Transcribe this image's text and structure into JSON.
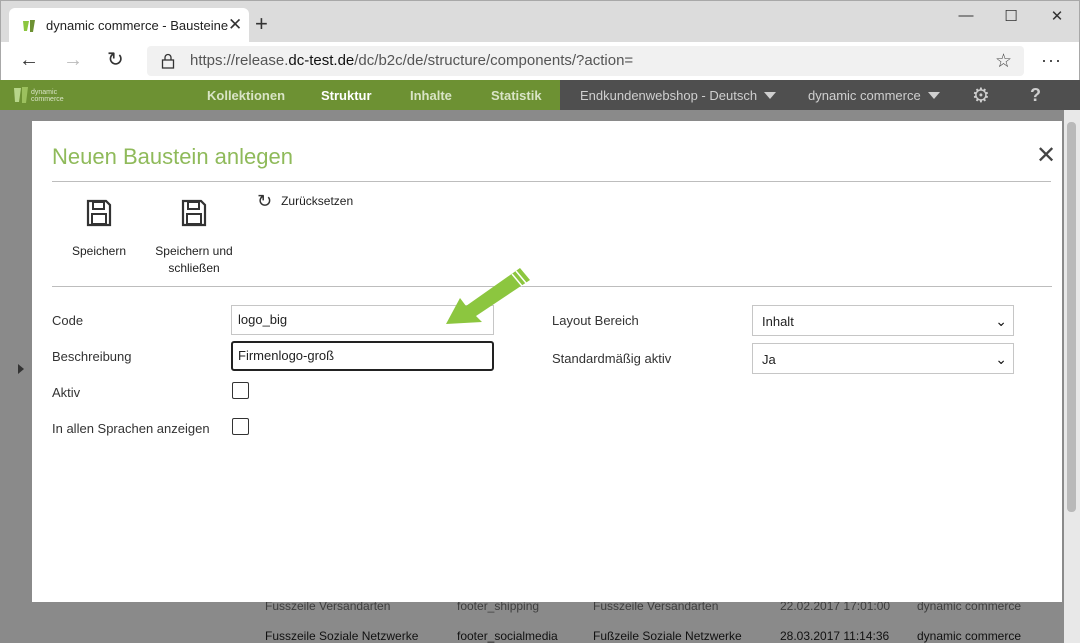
{
  "browser": {
    "tab_title": "dynamic commerce - Bausteine",
    "url_prefix": "https://release.",
    "url_domain": "dc-test.de",
    "url_path": "/dc/b2c/de/structure/components/?action="
  },
  "app": {
    "logo_text_1": "dynamic",
    "logo_text_2": "commerce",
    "nav": [
      "Kollektionen",
      "Struktur",
      "Inhalte",
      "Statistik"
    ],
    "shop_selector": "Endkundenwebshop - Deutsch",
    "company_selector": "dynamic commerce",
    "help": "?"
  },
  "background_rows": [
    [
      "Fusszeile Versandarten",
      "footer_shipping",
      "Fusszeile Versandarten",
      "22.02.2017 17:01:00",
      "dynamic commerce"
    ],
    [
      "Fusszeile Soziale Netzwerke",
      "footer_socialmedia",
      "Fußzeile Soziale Netzwerke",
      "28.03.2017 11:14:36",
      "dynamic commerce"
    ]
  ],
  "modal": {
    "title": "Neuen Baustein anlegen",
    "toolbar": {
      "save": "Speichern",
      "save_close_1": "Speichern und",
      "save_close_2": "schließen",
      "reset": "Zurücksetzen"
    },
    "form": {
      "code_label": "Code",
      "code_value": "logo_big",
      "description_label": "Beschreibung",
      "description_value": "Firmenlogo-groß",
      "active_label": "Aktiv",
      "active_checked": false,
      "all_languages_label": "In allen Sprachen anzeigen",
      "all_languages_checked": false,
      "layout_area_label": "Layout Bereich",
      "layout_area_value": "Inhalt",
      "default_active_label": "Standardmäßig aktiv",
      "default_active_value": "Ja"
    }
  },
  "colors": {
    "brand_green": "#6d9133",
    "title_green": "#8fba5a",
    "arrow_green": "#8cc63f"
  }
}
